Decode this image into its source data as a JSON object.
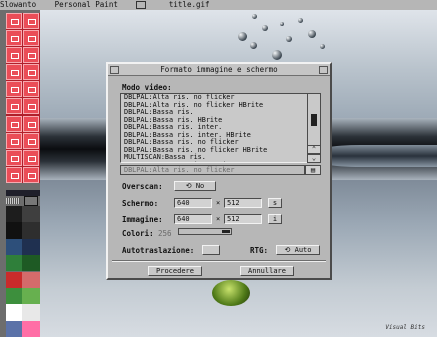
{
  "titlebar": {
    "app": "Slowanto",
    "program": "Personal Paint",
    "filename": "title.gif"
  },
  "toolbox": {
    "tool_count": 20
  },
  "palette": {
    "colors": [
      "#1d1d1d",
      "#3f3f3f",
      "#111111",
      "#2e2e2e",
      "#2d4f7a",
      "#1f3050",
      "#2f7f3a",
      "#1e5a24",
      "#c92b2b",
      "#d46b6b",
      "#3d8f3d",
      "#67b04f",
      "#ffffff",
      "#e8e8e8",
      "#5b72a8",
      "#ff6ea6"
    ]
  },
  "dialog": {
    "title": "Formato immagine e schermo",
    "video_mode_label": "Modo video:",
    "video_modes": [
      "DBLPAL:Alta ris. no flicker",
      "DBLPAL:Alta ris. no flicker HBrite",
      "DBLPAL:Bassa ris.",
      "DBLPAL:Bassa ris. HBrite",
      "DBLPAL:Bassa ris. inter.",
      "DBLPAL:Bassa ris. inter. HBrite",
      "DBLPAL:Bassa ris. no flicker",
      "DBLPAL:Bassa ris. no flicker HBrite",
      "MULTISCAN:Bassa ris.",
      "MULTISCAN:Bassa ris. HBrite"
    ],
    "selected_mode": "DBLPAL:Alta ris. no flicker",
    "overscan_label": "Overscan:",
    "overscan_value": "No",
    "screen_label": "Schermo:",
    "screen_width": "640",
    "screen_height": "512",
    "image_label": "Immagine:",
    "image_width": "640",
    "image_height": "512",
    "times_symbol": "×",
    "colors_label": "Colori:",
    "colors_value": "256",
    "autoscroll_label": "Autotraslazione:",
    "rtg_label": "RTG:",
    "rtg_value": "Auto",
    "proceed_label": "Procedere",
    "cancel_label": "Annullare",
    "scroll_up": "⌃",
    "scroll_down": "⌄",
    "screen_set": "s",
    "image_set": "i",
    "lock_glyph": "▤"
  },
  "scene": {
    "signature": "Visual Bits"
  }
}
